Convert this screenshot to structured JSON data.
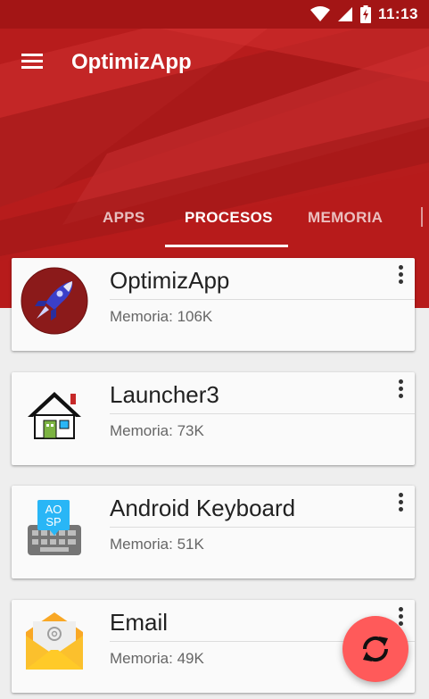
{
  "status_bar": {
    "time": "11:13",
    "icons": [
      "wifi-icon",
      "signal-icon",
      "battery-charging-icon"
    ]
  },
  "app_bar": {
    "title": "OptimizApp",
    "menu_icon": "hamburger-menu-icon"
  },
  "tabs": [
    {
      "label": "APPS",
      "selected": false
    },
    {
      "label": "PROCESOS",
      "selected": true
    },
    {
      "label": "MEMORIA",
      "selected": false
    }
  ],
  "processes": [
    {
      "name": "OptimizApp",
      "memory": "Memoria: 106K",
      "icon": "rocket-icon"
    },
    {
      "name": "Launcher3",
      "memory": "Memoria: 73K",
      "icon": "house-icon"
    },
    {
      "name": "Android Keyboard",
      "memory": "Memoria: 51K",
      "icon": "keyboard-icon",
      "icon_text_top": "AO",
      "icon_text_bottom": "SP"
    },
    {
      "name": "Email",
      "memory": "Memoria: 49K",
      "icon": "email-icon"
    }
  ],
  "fab": {
    "icon": "refresh-icon"
  },
  "colors": {
    "primary": "#b71c1c",
    "primary_dark": "#a31515",
    "fab": "#ff5a5a",
    "background": "#eeeeee"
  }
}
